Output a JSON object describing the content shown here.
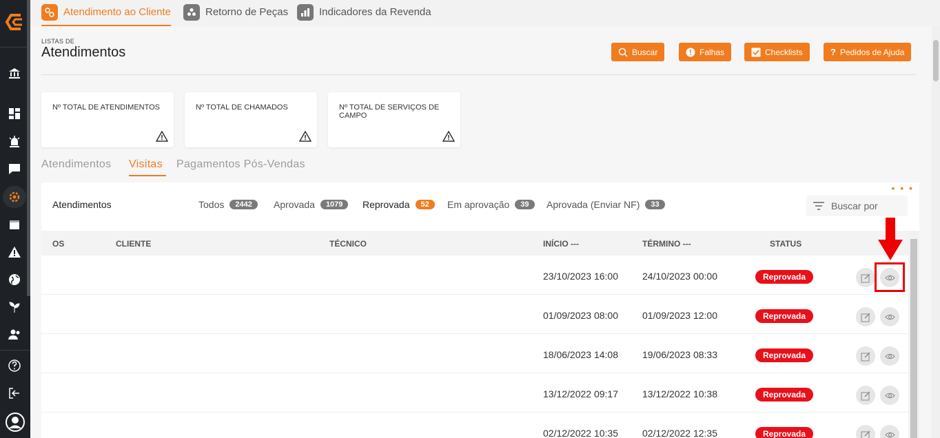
{
  "top_tabs": [
    {
      "label": "Atendimento ao Cliente",
      "icon": "support-icon",
      "active": true
    },
    {
      "label": "Retorno de Peças",
      "icon": "parts-icon",
      "active": false
    },
    {
      "label": "Indicadores da Revenda",
      "icon": "bar-chart-icon",
      "active": false
    }
  ],
  "header": {
    "subtitle": "LISTAS DE",
    "title": "Atendimentos",
    "buttons": [
      {
        "label": "Buscar",
        "icon": "search-icon"
      },
      {
        "label": "Falhas",
        "icon": "alert-icon"
      },
      {
        "label": "Checklists",
        "icon": "checkbox-icon"
      },
      {
        "label": "Pedidos de Ajuda",
        "icon": "help-icon"
      }
    ]
  },
  "cards": [
    {
      "title": "Nº TOTAL DE ATENDIMENTOS"
    },
    {
      "title": "Nº TOTAL DE CHAMADOS"
    },
    {
      "title": "Nº TOTAL DE SERVIÇOS DE CAMPO"
    }
  ],
  "sub_tabs": [
    {
      "label": "Atendimentos",
      "active": false
    },
    {
      "label": "Visitas",
      "active": true
    },
    {
      "label": "Pagamentos Pós-Vendas",
      "active": false
    }
  ],
  "panel": {
    "title": "Atendimentos",
    "filters": [
      {
        "label": "Todos",
        "count": "2442"
      },
      {
        "label": "Aprovada",
        "count": "1079"
      },
      {
        "label": "Reprovada",
        "count": "52"
      },
      {
        "label": "Em aprovação",
        "count": "39"
      },
      {
        "label": "Aprovada (Enviar NF)",
        "count": "33"
      }
    ],
    "search_placeholder": "Buscar por",
    "columns": {
      "os": "OS",
      "cliente": "CLIENTE",
      "tecnico": "TÉCNICO",
      "inicio": "INÍCIO ---",
      "termino": "TÉRMINO ---",
      "status": "STATUS"
    },
    "rows": [
      {
        "inicio": "23/10/2023 16:00",
        "termino": "24/10/2023 00:00",
        "status": "Reprovada"
      },
      {
        "inicio": "01/09/2023 08:00",
        "termino": "01/09/2023 12:00",
        "status": "Reprovada"
      },
      {
        "inicio": "18/06/2023 14:08",
        "termino": "19/06/2023 08:33",
        "status": "Reprovada"
      },
      {
        "inicio": "13/12/2022 09:17",
        "termino": "13/12/2022 10:38",
        "status": "Reprovada"
      },
      {
        "inicio": "02/12/2022 10:35",
        "termino": "02/12/2022 12:35",
        "status": "Reprovada"
      }
    ]
  },
  "colors": {
    "accent": "#f07c1f",
    "status_red": "#e8101a",
    "sidebar": "#1e2226"
  }
}
